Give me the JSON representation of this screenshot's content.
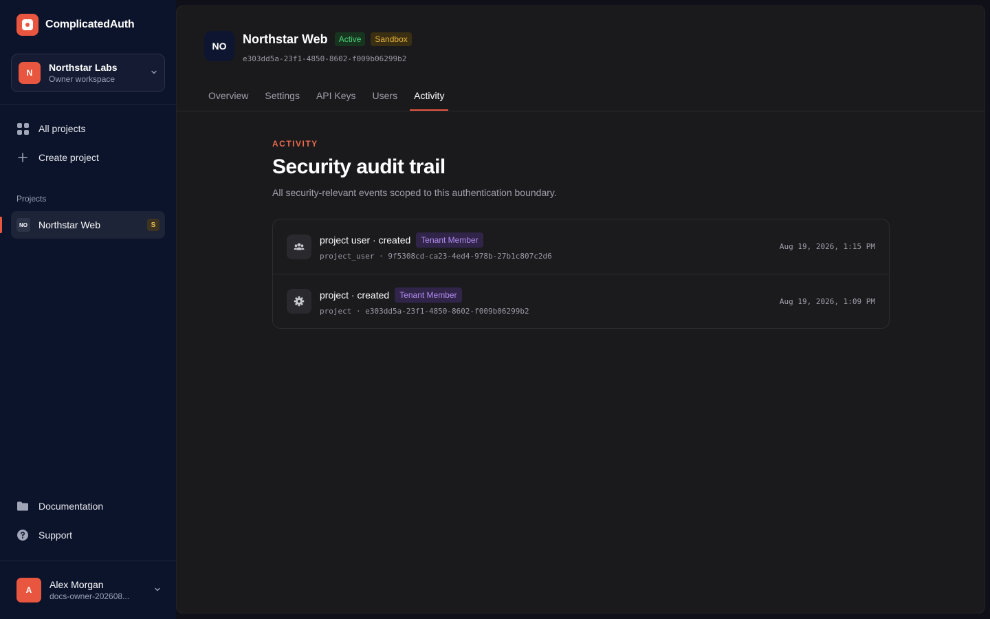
{
  "brand": {
    "name": "ComplicatedAuth",
    "icon": "logo-icon",
    "accent": "#e8563f"
  },
  "workspace": {
    "avatar": "N",
    "name": "Northstar Labs",
    "subtitle": "Owner workspace",
    "icon": "chevron-down-icon"
  },
  "nav": {
    "all_projects": "All projects",
    "create_project": "Create project",
    "section_label": "Projects",
    "project": {
      "avatar": "NO",
      "name": "Northstar Web",
      "badge": "S"
    },
    "documentation": "Documentation",
    "support": "Support"
  },
  "user": {
    "avatar": "A",
    "name": "Alex Morgan",
    "subtitle": "docs-owner-202608..."
  },
  "project_header": {
    "avatar": "NO",
    "title": "Northstar Web",
    "status_badge": "Active",
    "env_badge": "Sandbox",
    "id": "e303dd5a-23f1-4850-8602-f009b06299b2"
  },
  "tabs": [
    {
      "label": "Overview"
    },
    {
      "label": "Settings"
    },
    {
      "label": "API Keys"
    },
    {
      "label": "Users"
    },
    {
      "label": "Activity",
      "active": true
    }
  ],
  "activity": {
    "eyebrow": "ACTIVITY",
    "title": "Security audit trail",
    "description": "All security-relevant events scoped to this authentication boundary.",
    "events": [
      {
        "icon": "users-icon",
        "title": "project user · created",
        "role": "Tenant Member",
        "subject": "project_user · 9f5308cd-ca23-4ed4-978b-27b1c807c2d6",
        "time": "Aug 19, 2026, 1:15 PM"
      },
      {
        "icon": "gear-icon",
        "title": "project · created",
        "role": "Tenant Member",
        "subject": "project · e303dd5a-23f1-4850-8602-f009b06299b2",
        "time": "Aug 19, 2026, 1:09 PM"
      }
    ]
  }
}
